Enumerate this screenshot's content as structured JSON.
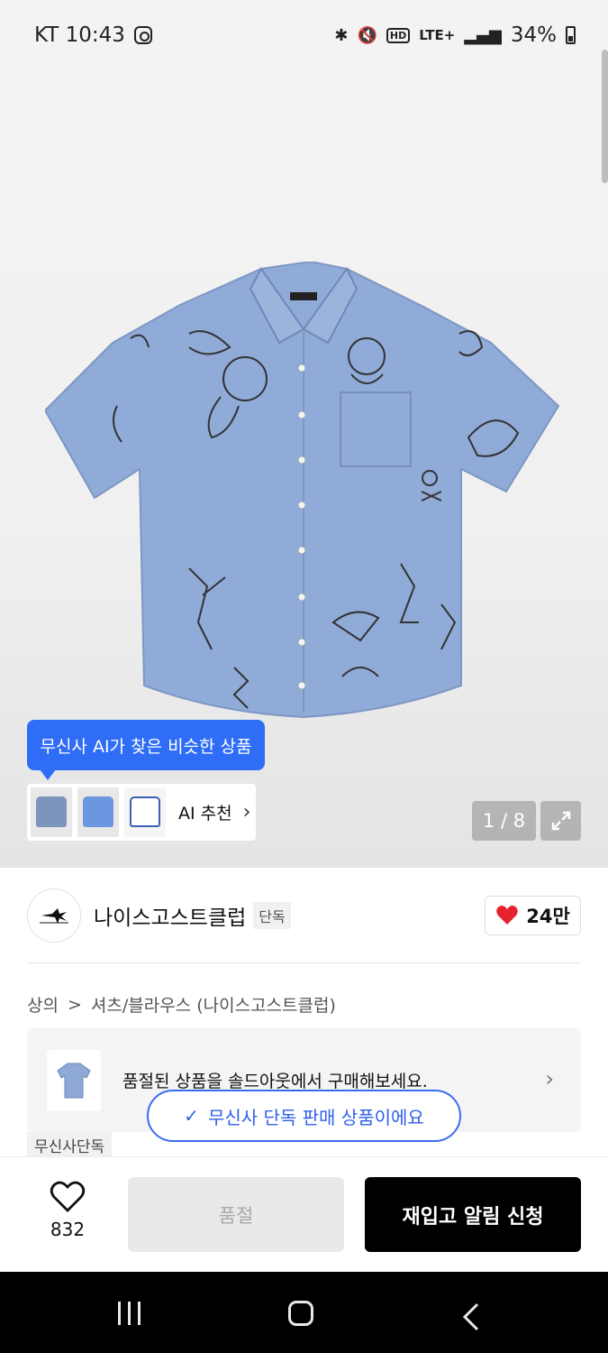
{
  "status": {
    "carrier_time": "KT 10:43",
    "network": "LTE+",
    "battery": "34%"
  },
  "hero": {
    "ai_tooltip": "무신사 AI가 찾은 비슷한 상품",
    "ai_label": "AI 추천",
    "page_counter": "1 / 8"
  },
  "brand": {
    "name": "나이스고스트클럽",
    "badge": "단독",
    "likes": "24만"
  },
  "breadcrumb": {
    "category": "상의",
    "separator": ">",
    "subcategory": "셔츠/블라우스 (나이스고스트클럽)"
  },
  "soldout_notice": {
    "text": "품절된 상품을 솔드아웃에서 구매해보세요."
  },
  "toast": {
    "text": "무신사 단독 판매 상품이에요"
  },
  "tag": {
    "text": "무신사단독"
  },
  "bottom": {
    "wish_count": "832",
    "soldout_label": "품절",
    "restock_label": "재입고 알림 신청"
  },
  "colors": {
    "accent_blue": "#2f6df6",
    "like_red": "#e8212e",
    "shirt_blue": "#8fa9d6"
  }
}
